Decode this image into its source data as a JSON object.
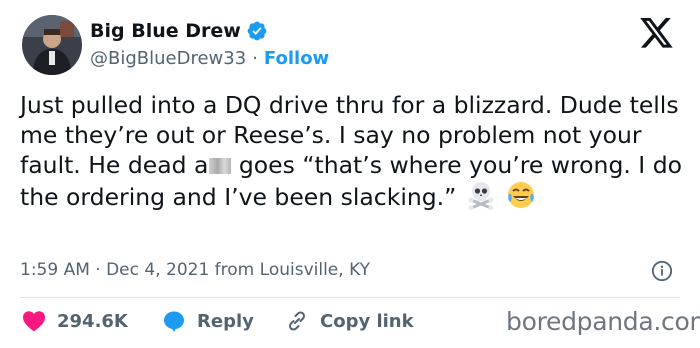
{
  "user": {
    "display_name": "Big Blue Drew",
    "handle": "@BigBlueDrew33",
    "separator": "·",
    "follow_label": "Follow"
  },
  "tweet": {
    "text_part1": "Just pulled into a DQ drive thru for a blizzard. Dude tells me they’re out or Reese’s. I say no problem not your fault. He dead a",
    "text_part2": " goes “that’s where you’re wrong. I do the ordering and I’ve been slacking.”",
    "emojis": [
      "skull-and-crossbones",
      "face-with-tears-of-joy"
    ]
  },
  "meta": {
    "timestamp": "1:59 AM · Dec 4, 2021 from Louisville, KY"
  },
  "actions": {
    "like_count": "294.6K",
    "reply_label": "Reply",
    "copy_link_label": "Copy link"
  },
  "watermark": "boredpanda.com",
  "colors": {
    "accent": "#1d9bf0",
    "like": "#f91880",
    "text": "#0f1419",
    "muted": "#536471"
  }
}
